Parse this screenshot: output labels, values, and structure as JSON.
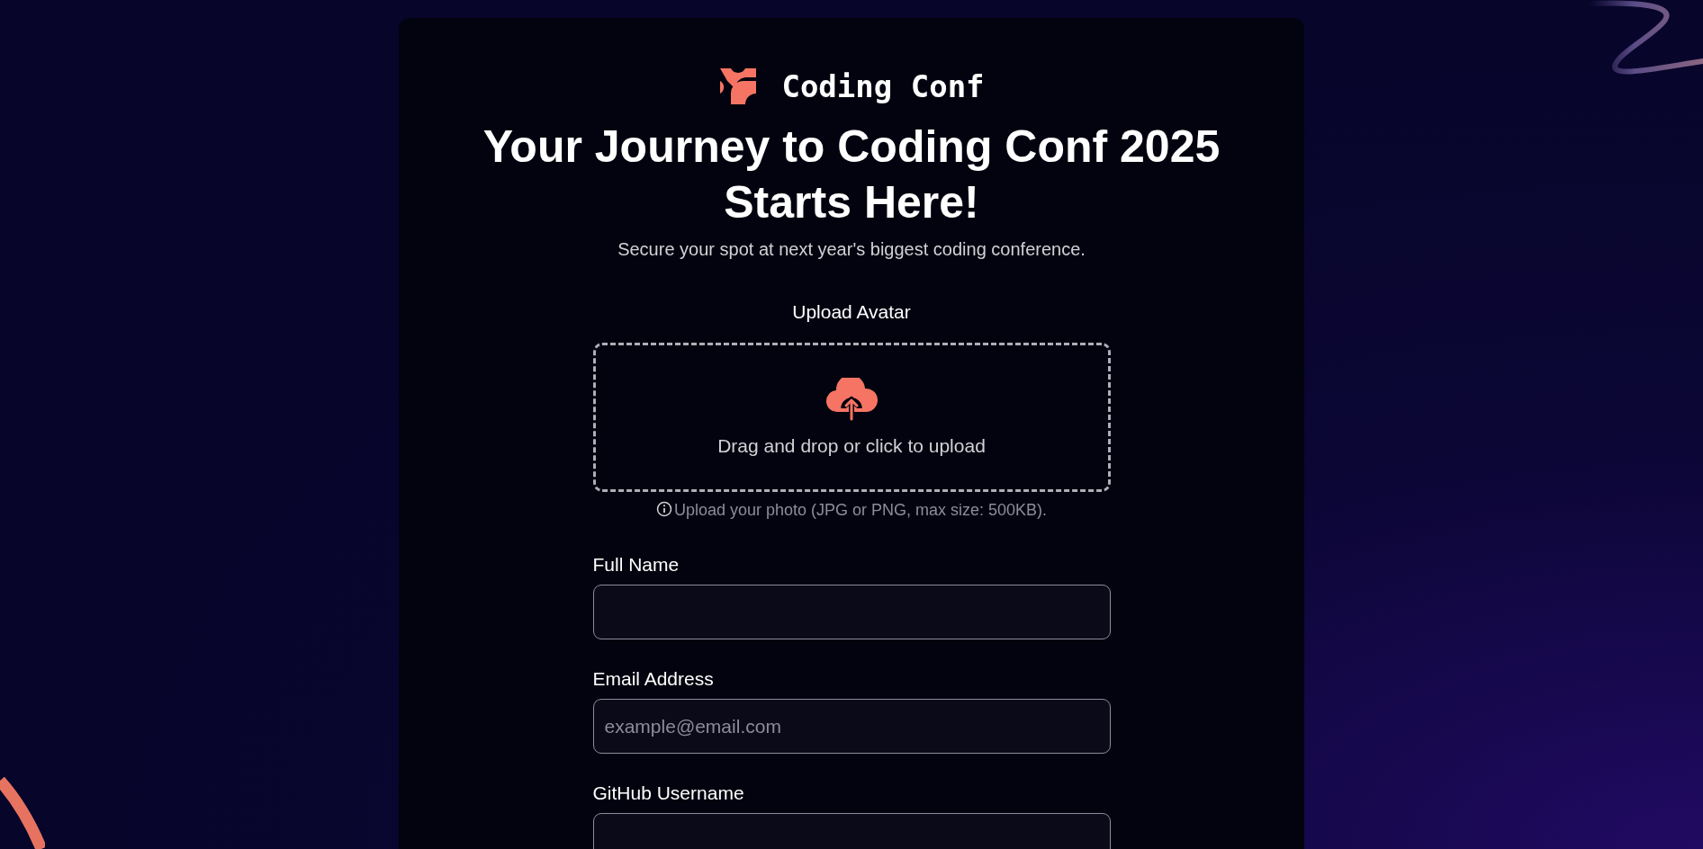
{
  "logo": {
    "text": "Coding Conf"
  },
  "heading": {
    "lines": [
      "Your Journey to Coding Conf 2025",
      "Starts Here!"
    ]
  },
  "subtitle": "Secure your spot at next year's biggest coding conference.",
  "upload": {
    "label": "Upload Avatar",
    "prompt": "Drag and drop or click to upload",
    "hint": "Upload your photo (JPG or PNG, max size: 500KB)."
  },
  "fields": [
    {
      "label": "Full Name"
    },
    {
      "label": "Email Address",
      "placeholder": "example@email.com"
    },
    {
      "label": "GitHub Username"
    }
  ]
}
